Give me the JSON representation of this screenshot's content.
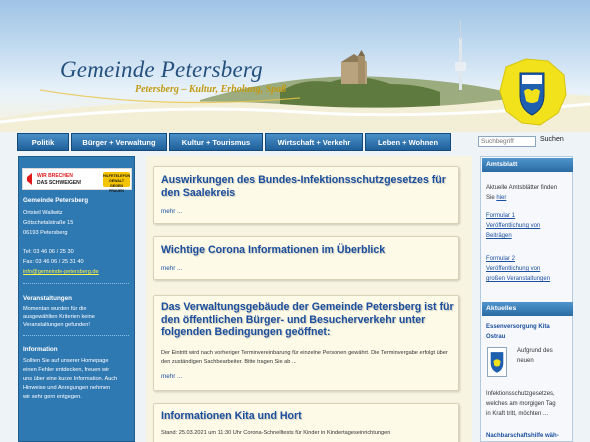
{
  "header": {
    "title": "Gemeinde Petersberg",
    "subtitle": "Petersberg – Kultur, Erholung, Spaß"
  },
  "nav": {
    "items": [
      {
        "label": "Politik"
      },
      {
        "label": "Bürger + Verwaltung"
      },
      {
        "label": "Kultur + Tourismus"
      },
      {
        "label": "Wirtschaft + Verkehr"
      },
      {
        "label": "Leben + Wohnen"
      }
    ]
  },
  "search": {
    "placeholder": "Suchbegriff",
    "button_label": "Suchen"
  },
  "left": {
    "banner_line1": "WIR BRECHEN",
    "banner_line2": "DAS SCHWEIGEN!",
    "banner_badge": "HILFETELEFON GEWALT GEGEN FRAUEN",
    "org_name": "Gemeinde Petersberg",
    "address1": "Ortsteil Wallwitz",
    "address2": "Götschetalstraße 15",
    "address3": "06193 Petersberg",
    "tel": "Tel:  03 46 06 / 25 30",
    "fax": "Fax: 03 46 06 / 25 31 40",
    "email": "info@gemeinde-petersberg.de",
    "events_title": "Veranstaltungen",
    "events_text": [
      "Momentan wurden für die",
      "ausgewählten Kriterien keine",
      "Veranstaltungen gefunden!"
    ],
    "info_title": "Information",
    "info_text": [
      "Sollten Sie auf unserer Homepage",
      "einen Fehler entdecken, freuen wir",
      "uns über eine kurze Information. Auch",
      "Hinweise und Anregungen nehmen",
      "wir sehr gern entgegen."
    ]
  },
  "main": {
    "cards": [
      {
        "title": "Auswirkungen des Bundes-Infektionsschutzgesetzes für den Saalekreis",
        "more": "mehr ..."
      },
      {
        "title": "Wichtige Corona Informationen im Überblick",
        "more": "mehr ..."
      },
      {
        "title": "Das Verwaltungsgebäude der Gemeinde Petersberg ist für den öffentlichen Bürger- und Besucherverkehr unter folgenden Bedingungen geöffnet:",
        "text": "Der Eintritt wird nach vorheriger Terminvereinbarung für einzelne Personen gewährt. Die Terminvergabe erfolgt über den zuständigen Sachbearbeiter.  Bitte tragen Sie ab ...",
        "more": "mehr ..."
      },
      {
        "title": "Informationen Kita und Hort",
        "text": "Stand: 25.03.2021 um 11:30 Uhr Corona-Schnelltests für Kinder in Kindertageseinrichtungen"
      }
    ]
  },
  "right": {
    "amtsblatt_title": "Amtsblatt",
    "amtsblatt_line1": "Aktuelle Amtsblätter finden",
    "amtsblatt_line2_pre": "Sie ",
    "amtsblatt_line2_link": "hier",
    "link1": [
      "Formular 1",
      "Veröffentlichung von",
      "Beiträgen"
    ],
    "link2": [
      "Formular 2",
      "Veröffentlichung von",
      "großen Veranstaltungen"
    ],
    "aktuelles_title": "Aktuelles",
    "news1_title": [
      "Essenversorgung Kita",
      "Ostrau"
    ],
    "news1_text": [
      "Aufgrund des",
      "neuen"
    ],
    "news1_cont": [
      "Infektionsschutzgesetzes,",
      "welches am morgigen Tag",
      "in Kraft tritt, möchten ..."
    ],
    "news2_title": "Nachbarschaftshilfe wäh-"
  }
}
